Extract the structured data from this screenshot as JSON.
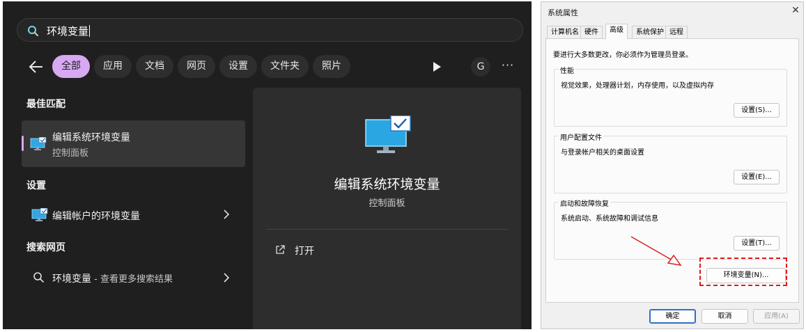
{
  "search": {
    "query": "环境变量",
    "filters": [
      "全部",
      "应用",
      "文档",
      "网页",
      "设置",
      "文件夹",
      "照片"
    ],
    "active_filter_index": 0,
    "account_initial": "G",
    "more_label": "···"
  },
  "results": {
    "best_match_heading": "最佳匹配",
    "best_match": {
      "title": "编辑系统环境变量",
      "subtitle": "控制面板"
    },
    "settings_heading": "设置",
    "settings_item": {
      "title": "编辑帐户的环境变量"
    },
    "web_heading": "搜索网页",
    "web_item": {
      "title": "环境变量",
      "suffix": " - 查看更多搜索结果"
    }
  },
  "preview": {
    "title": "编辑系统环境变量",
    "subtitle": "控制面板",
    "open_label": "打开"
  },
  "dialog": {
    "title": "系统属性",
    "close_glyph": "✕",
    "tabs": [
      "计算机名",
      "硬件",
      "高级",
      "系统保护",
      "远程"
    ],
    "active_tab_index": 2,
    "admin_note": "要进行大多数更改，你必须作为管理员登录。",
    "groups": [
      {
        "label": "性能",
        "desc": "视觉效果，处理器计划，内存使用，以及虚拟内存",
        "button": "设置(S)..."
      },
      {
        "label": "用户配置文件",
        "desc": "与登录帐户相关的桌面设置",
        "button": "设置(E)..."
      },
      {
        "label": "启动和故障恢复",
        "desc": "系统启动、系统故障和调试信息",
        "button": "设置(T)..."
      }
    ],
    "env_button": "环境变量(N)...",
    "ok_button": "确定",
    "cancel_button": "取消",
    "apply_button": "应用(A)"
  },
  "colors": {
    "panel_bg": "#1f1f1f",
    "accent_chip": "#d7a9f2",
    "annotation_red": "#e01b1b",
    "dialog_bg": "#f0f0f0"
  },
  "icons": [
    "search-icon",
    "back-arrow-icon",
    "play-icon",
    "more-icon",
    "monitor-check-icon",
    "chevron-right-icon",
    "open-external-icon",
    "close-icon"
  ]
}
